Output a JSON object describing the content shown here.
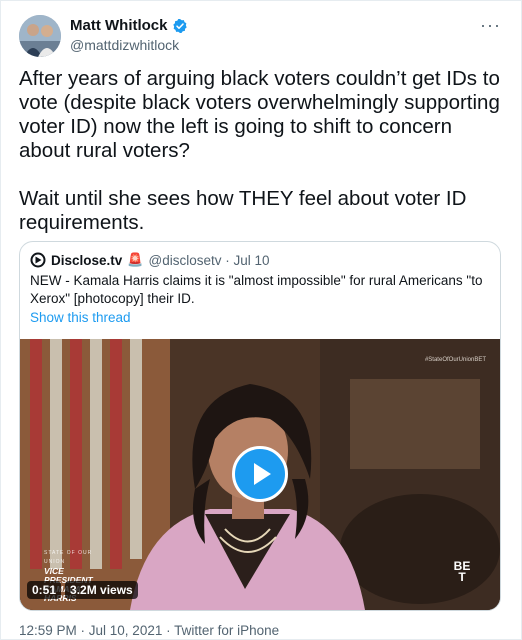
{
  "tweet": {
    "author_name": "Matt Whitlock",
    "author_handle": "@mattdizwhitlock",
    "more_label": "···",
    "paragraphs": [
      "After years of arguing black voters couldn’t get IDs to vote (despite black voters overwhelmingly supporting voter ID) now the left is going to shift to concern about rural voters?",
      "Wait until she sees how THEY feel about voter ID requirements."
    ],
    "footer": "12:59 PM · Jul 10, 2021 · Twitter for iPhone"
  },
  "quoted": {
    "name": "Disclose.tv",
    "siren": "🚨",
    "handle_date": "@disclosetv · Jul 10",
    "text": "NEW - Kamala Harris claims it is \"almost impossible\" for rural Americans \"to Xerox\" [photocopy] their ID.",
    "show_thread": "Show this thread",
    "video": {
      "watermark": "#StateOfOurUnionBET",
      "lower_third_top": "STATE OF OUR UNION",
      "lower_third_line1": "VICE PRESIDENT",
      "lower_third_line2": "KAMALA HARRIS",
      "network_logo_top": "BE",
      "network_logo_bottom": "T",
      "duration": "0:51",
      "views": "3.2M views"
    }
  },
  "colors": {
    "accent": "#1d9bf0",
    "text": "#0f1419",
    "secondary": "#536471",
    "border": "#cfd9de"
  }
}
